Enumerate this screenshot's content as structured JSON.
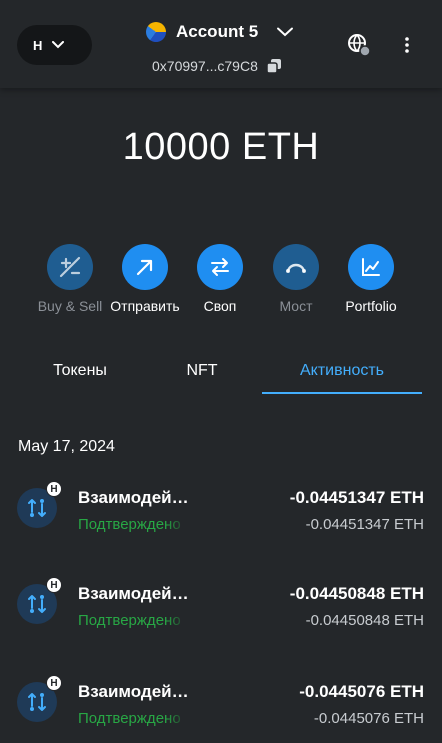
{
  "header": {
    "network_label": "H",
    "account_name": "Account 5",
    "address": "0x70997...c79C8"
  },
  "balance": "10000 ETH",
  "actions": [
    {
      "label": "Buy & Sell",
      "icon": "buy-sell-icon",
      "enabled": false
    },
    {
      "label": "Отправить",
      "icon": "send-arrow-icon",
      "enabled": true
    },
    {
      "label": "Своп",
      "icon": "swap-icon",
      "enabled": true
    },
    {
      "label": "Мост",
      "icon": "bridge-icon",
      "enabled": false
    },
    {
      "label": "Portfolio",
      "icon": "portfolio-chart-icon",
      "enabled": true
    }
  ],
  "tabs": [
    {
      "label": "Токены",
      "active": false
    },
    {
      "label": "NFT",
      "active": false
    },
    {
      "label": "Активность",
      "active": true
    }
  ],
  "activity": {
    "date": "May 17, 2024",
    "items": [
      {
        "title": "Взаимодействие с контрактом",
        "status": "Подтверждено",
        "amount": "-0.04451347 ETH",
        "fiat": "-0.04451347 ETH",
        "badge": "H"
      },
      {
        "title": "Взаимодействие с контрактом",
        "status": "Подтверждено",
        "amount": "-0.04450848 ETH",
        "fiat": "-0.04450848 ETH",
        "badge": "H"
      },
      {
        "title": "Взаимодействие с контрактом",
        "status": "Подтверждено",
        "amount": "-0.0445076 ETH",
        "fiat": "-0.0445076 ETH",
        "badge": "H"
      }
    ]
  },
  "colors": {
    "background": "#24272a",
    "accent": "#43aefc",
    "action_primary": "#1f8ef1",
    "action_disabled": "#1f5d91",
    "success": "#28a745"
  }
}
